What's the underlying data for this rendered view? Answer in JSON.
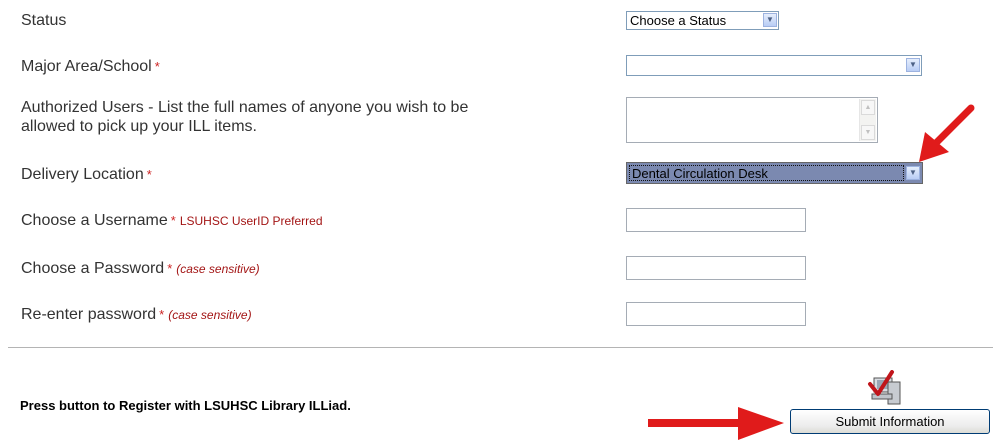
{
  "form": {
    "status": {
      "label": "Status",
      "selected": "Choose a Status"
    },
    "major": {
      "label": "Major Area/School",
      "required": "*",
      "selected": ""
    },
    "authorized": {
      "label_line1": "Authorized Users - List the full names of anyone you wish to be",
      "label_line2": "allowed to pick up your ILL items.",
      "value": ""
    },
    "delivery": {
      "label": "Delivery Location",
      "required": "*",
      "selected": "Dental Circulation Desk"
    },
    "username": {
      "label": "Choose a Username",
      "required": "*",
      "note": "LSUHSC UserID Preferred",
      "value": ""
    },
    "password": {
      "label": "Choose a Password",
      "required": "*",
      "note": "(case sensitive)",
      "value": ""
    },
    "password2": {
      "label": "Re-enter password",
      "required": "*",
      "note": "(case sensitive)",
      "value": ""
    }
  },
  "footer": {
    "press_text": "Press button to Register with LSUHSC Library ILLiad.",
    "submit_label": "Submit Information"
  },
  "colors": {
    "accent_arrow": "#e01b1b",
    "required": "#cc2222",
    "note": "#a31515",
    "highlight": "#7b89b0"
  },
  "icons": {
    "dropdown": "chevron-down-icon",
    "submit_icon": "computer-check-icon",
    "annotation": "red-arrow-icon"
  }
}
